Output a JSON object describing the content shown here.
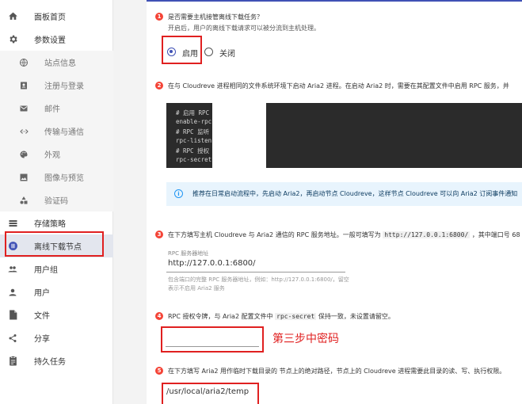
{
  "sidebar": {
    "items": [
      {
        "label": "面板首页",
        "icon": "home-icon"
      },
      {
        "label": "参数设置",
        "icon": "gear-icon"
      },
      {
        "label": "站点信息",
        "icon": "globe-icon"
      },
      {
        "label": "注册与登录",
        "icon": "contact-card-icon"
      },
      {
        "label": "邮件",
        "icon": "mail-icon"
      },
      {
        "label": "传输与通信",
        "icon": "code-arrows-icon"
      },
      {
        "label": "外观",
        "icon": "palette-icon"
      },
      {
        "label": "图像与预览",
        "icon": "image-icon"
      },
      {
        "label": "验证码",
        "icon": "shapes-icon"
      },
      {
        "label": "存储策略",
        "icon": "storage-list-icon"
      },
      {
        "label": "离线下载节点",
        "icon": "download-node-icon"
      },
      {
        "label": "用户组",
        "icon": "group-icon"
      },
      {
        "label": "用户",
        "icon": "person-icon"
      },
      {
        "label": "文件",
        "icon": "file-icon"
      },
      {
        "label": "分享",
        "icon": "share-icon"
      },
      {
        "label": "持久任务",
        "icon": "clipboard-icon"
      }
    ],
    "active_label": "离线下载节点"
  },
  "step1": {
    "num": "1",
    "question": "是否需要主机接管离线下载任务？",
    "desc": "开启后，用户的离线下载请求可以被分流到主机处理。",
    "options": {
      "enable": "启用",
      "disable": "关闭"
    },
    "selected": "启用"
  },
  "step2": {
    "num": "2",
    "text": "在与 Cloudreve 进程相同的文件系统环境下启动 Aria2 进程。在启动 Aria2 时，需要在其配置文件中启用 RPC 服务，并",
    "code_lines": [
      "# 启用 RPC",
      "enable-rpc",
      "# RPC 监听",
      "rpc-listen",
      "# RPC 授权",
      "rpc-secret"
    ],
    "info": "推荐在日常启动流程中，先启动 Aria2，再启动节点 Cloudreve，这样节点 Cloudreve 可以向 Aria2 订阅事件通知"
  },
  "step3": {
    "num": "3",
    "text_before": "在下方填写主机 Cloudreve 与 Aria2 通信的 RPC 服务地址。一般可填写为",
    "code": "http://127.0.0.1:6800/",
    "text_after": "，其中端口号 68",
    "field_label": "RPC 服务器地址",
    "field_value": "http://127.0.0.1:6800/",
    "help_1": "包含端口的完整 RPC 服务器地址，例如：http://127.0.0.1:6800/，留空",
    "help_2": "表示不启用 Aria2 服务"
  },
  "step4": {
    "num": "4",
    "text_before": "RPC 授权令牌，与 Aria2 配置文件中",
    "code": "rpc-secret",
    "text_after": "保持一致，未设置请留空。",
    "field_value": "",
    "annotation": "第三步中密码"
  },
  "step5": {
    "num": "5",
    "text": "在下方填写 Aria2 用作临时下载目录的 节点上的绝对路径，节点上的 Cloudreve 进程需要此目录的读、写、执行权限。",
    "field_value": "/usr/local/aria2/temp"
  },
  "colors": {
    "accent": "#3f51b5",
    "annotation_red": "#e02020",
    "step_badge": "#f44336"
  }
}
